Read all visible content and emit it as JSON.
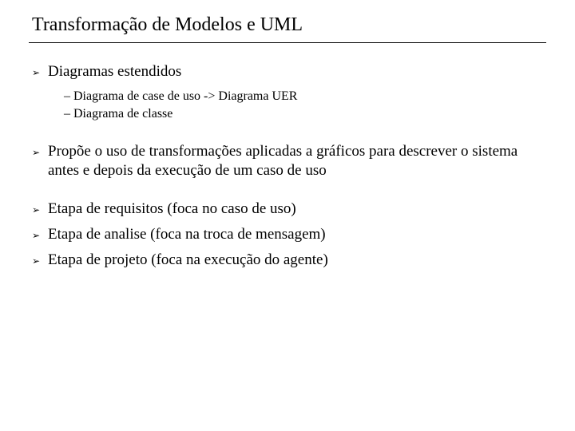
{
  "title": "Transformação de Modelos e UML",
  "bullets": {
    "b1": {
      "text": "Diagramas estendidos"
    },
    "b1_sub": {
      "s1": "– Diagrama de case de uso -> Diagrama UER",
      "s2": "– Diagrama de classe"
    },
    "b2": {
      "text": "Propõe o uso de transformações aplicadas a gráficos para descrever o sistema antes e depois da execução de um caso de uso"
    },
    "b3": {
      "text": "Etapa de requisitos (foca no caso de uso)"
    },
    "b4": {
      "text": "Etapa de analise (foca na troca de mensagem)"
    },
    "b5": {
      "text": "Etapa de projeto (foca na execução do agente)"
    }
  },
  "glyphs": {
    "triangle": "➢"
  }
}
